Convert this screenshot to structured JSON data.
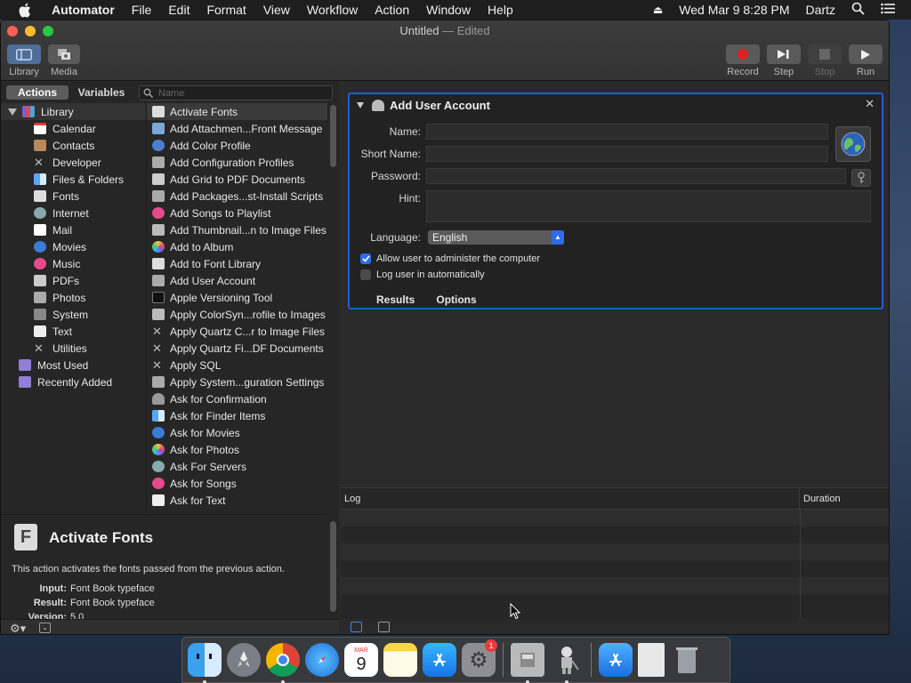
{
  "menubar": {
    "app": "Automator",
    "items": [
      "File",
      "Edit",
      "Format",
      "View",
      "Workflow",
      "Action",
      "Window",
      "Help"
    ],
    "clock": "Wed Mar 9  8:28 PM",
    "user": "Dartz"
  },
  "window": {
    "title": "Untitled",
    "title_suffix": "— Edited",
    "toolbar": {
      "library": "Library",
      "media": "Media",
      "record": "Record",
      "step": "Step",
      "stop": "Stop",
      "run": "Run"
    }
  },
  "library": {
    "tab_actions": "Actions",
    "tab_variables": "Variables",
    "search_placeholder": "Name",
    "root": "Library",
    "categories": [
      "Calendar",
      "Contacts",
      "Developer",
      "Files & Folders",
      "Fonts",
      "Internet",
      "Mail",
      "Movies",
      "Music",
      "PDFs",
      "Photos",
      "System",
      "Text",
      "Utilities"
    ],
    "most_used": "Most Used",
    "recently_added": "Recently Added",
    "actions": [
      "Activate Fonts",
      "Add Attachmen...Front Message",
      "Add Color Profile",
      "Add Configuration Profiles",
      "Add Grid to PDF Documents",
      "Add Packages...st-Install Scripts",
      "Add Songs to Playlist",
      "Add Thumbnail...n to Image Files",
      "Add to Album",
      "Add to Font Library",
      "Add User Account",
      "Apple Versioning Tool",
      "Apply ColorSyn...rofile to Images",
      "Apply Quartz C...r to Image Files",
      "Apply Quartz Fi...DF Documents",
      "Apply SQL",
      "Apply System...guration Settings",
      "Ask for Confirmation",
      "Ask for Finder Items",
      "Ask for Movies",
      "Ask for Photos",
      "Ask For Servers",
      "Ask for Songs",
      "Ask for Text"
    ]
  },
  "description": {
    "title": "Activate Fonts",
    "body": "This action activates the fonts passed from the previous action.",
    "input_label": "Input:",
    "input": "Font Book typeface",
    "result_label": "Result:",
    "result": "Font Book typeface",
    "version_label": "Version:",
    "version": "5.0"
  },
  "action_box": {
    "title": "Add User Account",
    "name_label": "Name:",
    "short_name_label": "Short Name:",
    "password_label": "Password:",
    "hint_label": "Hint:",
    "language_label": "Language:",
    "language_value": "English",
    "admin_checkbox": "Allow user to administer the computer",
    "admin_checked": true,
    "autologin_checkbox": "Log user in automatically",
    "autologin_checked": false,
    "results_tab": "Results",
    "options_tab": "Options"
  },
  "log": {
    "col_log": "Log",
    "col_duration": "Duration"
  },
  "dock": {
    "calendar_month": "MAR",
    "calendar_day": "9",
    "notification_badge": "1"
  },
  "colors": {
    "accent": "#2f6bea",
    "selection_border": "#1f5bd6",
    "record_red": "#e02020"
  }
}
